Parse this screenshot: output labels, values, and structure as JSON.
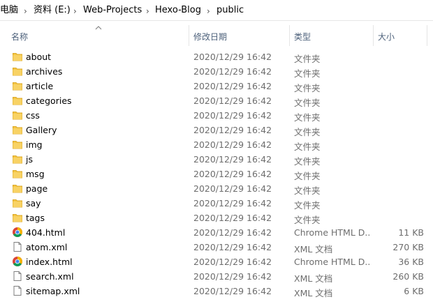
{
  "breadcrumb": {
    "segments": [
      "电脑",
      "资料 (E:)",
      "Web-Projects",
      "Hexo-Blog",
      "public"
    ],
    "separator": "›"
  },
  "columns": {
    "name": "名称",
    "modified": "修改日期",
    "type": "类型",
    "size": "大小"
  },
  "sort": {
    "column": "name",
    "direction": "ascending"
  },
  "files": [
    {
      "name": "about",
      "date": "2020/12/29 16:42",
      "type": "文件夹",
      "size": "",
      "icon": "folder-icon"
    },
    {
      "name": "archives",
      "date": "2020/12/29 16:42",
      "type": "文件夹",
      "size": "",
      "icon": "folder-icon"
    },
    {
      "name": "article",
      "date": "2020/12/29 16:42",
      "type": "文件夹",
      "size": "",
      "icon": "folder-icon"
    },
    {
      "name": "categories",
      "date": "2020/12/29 16:42",
      "type": "文件夹",
      "size": "",
      "icon": "folder-icon"
    },
    {
      "name": "css",
      "date": "2020/12/29 16:42",
      "type": "文件夹",
      "size": "",
      "icon": "folder-icon"
    },
    {
      "name": "Gallery",
      "date": "2020/12/29 16:42",
      "type": "文件夹",
      "size": "",
      "icon": "folder-icon"
    },
    {
      "name": "img",
      "date": "2020/12/29 16:42",
      "type": "文件夹",
      "size": "",
      "icon": "folder-icon"
    },
    {
      "name": "js",
      "date": "2020/12/29 16:42",
      "type": "文件夹",
      "size": "",
      "icon": "folder-icon"
    },
    {
      "name": "msg",
      "date": "2020/12/29 16:42",
      "type": "文件夹",
      "size": "",
      "icon": "folder-icon"
    },
    {
      "name": "page",
      "date": "2020/12/29 16:42",
      "type": "文件夹",
      "size": "",
      "icon": "folder-icon"
    },
    {
      "name": "say",
      "date": "2020/12/29 16:42",
      "type": "文件夹",
      "size": "",
      "icon": "folder-icon"
    },
    {
      "name": "tags",
      "date": "2020/12/29 16:42",
      "type": "文件夹",
      "size": "",
      "icon": "folder-icon"
    },
    {
      "name": "404.html",
      "date": "2020/12/29 16:42",
      "type": "Chrome HTML D...",
      "size": "11 KB",
      "icon": "chrome-icon"
    },
    {
      "name": "atom.xml",
      "date": "2020/12/29 16:42",
      "type": "XML 文档",
      "size": "270 KB",
      "icon": "document-icon"
    },
    {
      "name": "index.html",
      "date": "2020/12/29 16:42",
      "type": "Chrome HTML D...",
      "size": "36 KB",
      "icon": "chrome-icon"
    },
    {
      "name": "search.xml",
      "date": "2020/12/29 16:42",
      "type": "XML 文档",
      "size": "260 KB",
      "icon": "document-icon"
    },
    {
      "name": "sitemap.xml",
      "date": "2020/12/29 16:42",
      "type": "XML 文档",
      "size": "6 KB",
      "icon": "document-icon"
    }
  ],
  "colors": {
    "header_text": "#4c607a",
    "folder": "#f5c644",
    "secondary_text": "#6d6d6d"
  }
}
